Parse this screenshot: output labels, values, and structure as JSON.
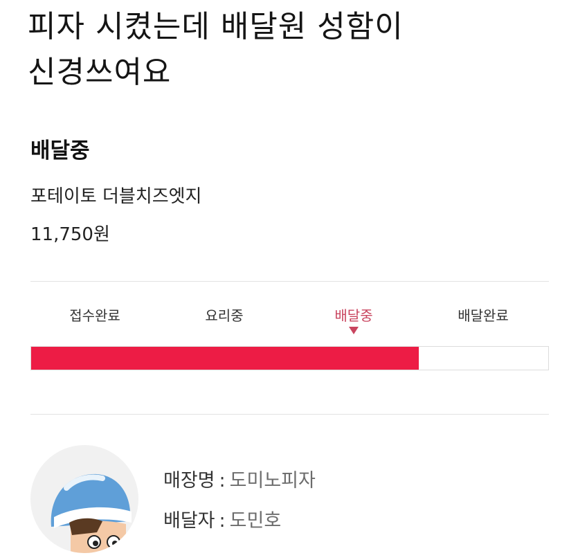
{
  "post": {
    "title_line1": "피자 시켰는데 배달원 성함이",
    "title_line2": "신경쓰여요"
  },
  "order": {
    "status_heading": "배달중",
    "item_name": "포테이토 더블치즈엣지",
    "price": "11,750원"
  },
  "tracker": {
    "steps": [
      {
        "label": "접수완료",
        "active": false
      },
      {
        "label": "요리중",
        "active": false
      },
      {
        "label": "배달중",
        "active": true
      },
      {
        "label": "배달완료",
        "active": false
      }
    ],
    "progress_fraction": 0.75,
    "active_color": "#c9455f",
    "bar_color": "#ed1c45"
  },
  "delivery": {
    "avatar_icon": "delivery-rider-avatar-icon",
    "store_label": "매장명",
    "store_value": "도미노피자",
    "rider_label": "배달자",
    "rider_value": "도민호",
    "separator": ":"
  }
}
